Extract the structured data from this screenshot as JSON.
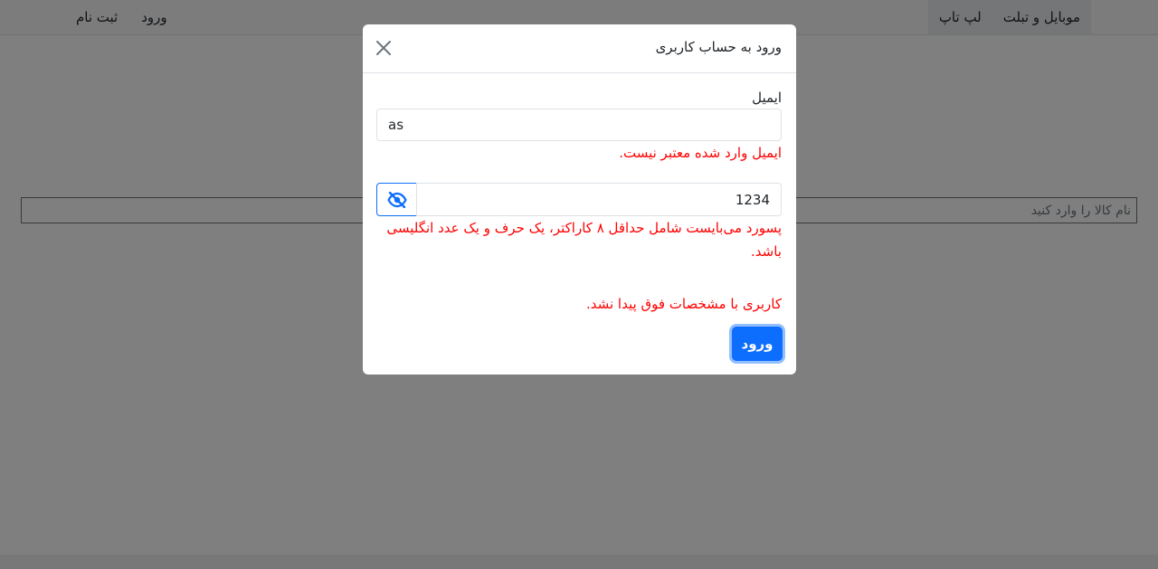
{
  "navbar": {
    "categories": [
      {
        "label": "موبایل و تبلت"
      },
      {
        "label": "لپ تاپ"
      }
    ],
    "login_label": "ورود",
    "register_label": "ثبت نام"
  },
  "search": {
    "placeholder": "نام کالا را وارد کنید"
  },
  "modal": {
    "title": "ورود به حساب کاربری",
    "email": {
      "label": "ایمیل",
      "value": "as",
      "error": "ایمیل وارد شده معتبر نیست."
    },
    "password": {
      "value": "1234",
      "error": "پسورد می‌بایست شامل حداقل ۸ کاراکتر، یک حرف و یک عدد انگلیسی باشد."
    },
    "general_error": "کاربری با مشخصات فوق پیدا نشد.",
    "submit_label": "ورود"
  },
  "colors": {
    "primary": "#0d6efd",
    "error": "#ff0000",
    "backdrop": "rgba(0,0,0,0.5)"
  },
  "icons": {
    "close": "close-icon",
    "toggle_password": "eye-slash-icon"
  }
}
